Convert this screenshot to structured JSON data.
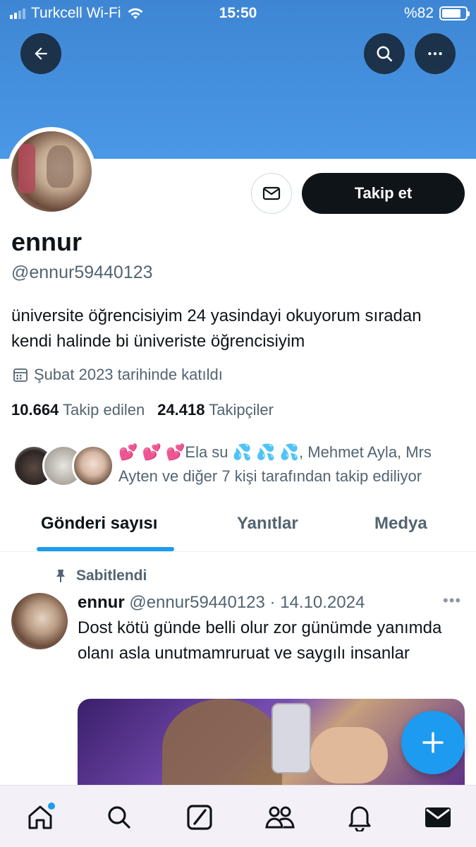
{
  "status_bar": {
    "carrier": "Turkcell Wi-Fi",
    "time": "15:50",
    "battery_text": "%82",
    "battery_level": 0.82
  },
  "header": {
    "back_icon": "arrow-left-icon",
    "search_icon": "search-icon",
    "more_icon": "more-icon"
  },
  "profile": {
    "message_icon": "envelope-icon",
    "follow_label": "Takip et",
    "name": "ennur",
    "handle": "@ennur59440123",
    "bio": "üniversite öğrencisiyim 24 yasindayi okuyorum sıradan kendi halinde bi üniveriste öğrencisiyim",
    "joined": "Şubat 2023 tarihinde katıldı",
    "following_count": "10.664",
    "following_label": "Takip edilen",
    "followers_count": "24.418",
    "followers_label": "Takipçiler",
    "followed_by_text": "💕 💕 💕Ela su 💦 💦 💦, Mehmet Ayla, Mrs Ayten ve diğer 7 kişi tarafından takip ediliyor"
  },
  "tabs": [
    {
      "label": "Gönderi sayısı",
      "active": true
    },
    {
      "label": "Yanıtlar",
      "active": false
    },
    {
      "label": "Medya",
      "active": false
    }
  ],
  "post": {
    "pinned_label": "Sabitlendi",
    "author": "ennur",
    "handle_date": "@ennur59440123 · 14.10.2024",
    "more": "•••",
    "text": "Dost kötü günde belli olur zor günümde yanımda olanı asla unutmamruruat ve saygılı insanlar"
  },
  "fab": {
    "icon": "plus-icon"
  },
  "bottom_nav": [
    {
      "name": "home-icon",
      "active": true
    },
    {
      "name": "search-icon"
    },
    {
      "name": "grok-icon"
    },
    {
      "name": "communities-icon"
    },
    {
      "name": "bell-icon"
    },
    {
      "name": "mail-icon"
    }
  ],
  "colors": {
    "accent": "#1d9bf0",
    "banner": "#4a98e6",
    "text": "#0f1419",
    "secondary_text": "#536471"
  }
}
